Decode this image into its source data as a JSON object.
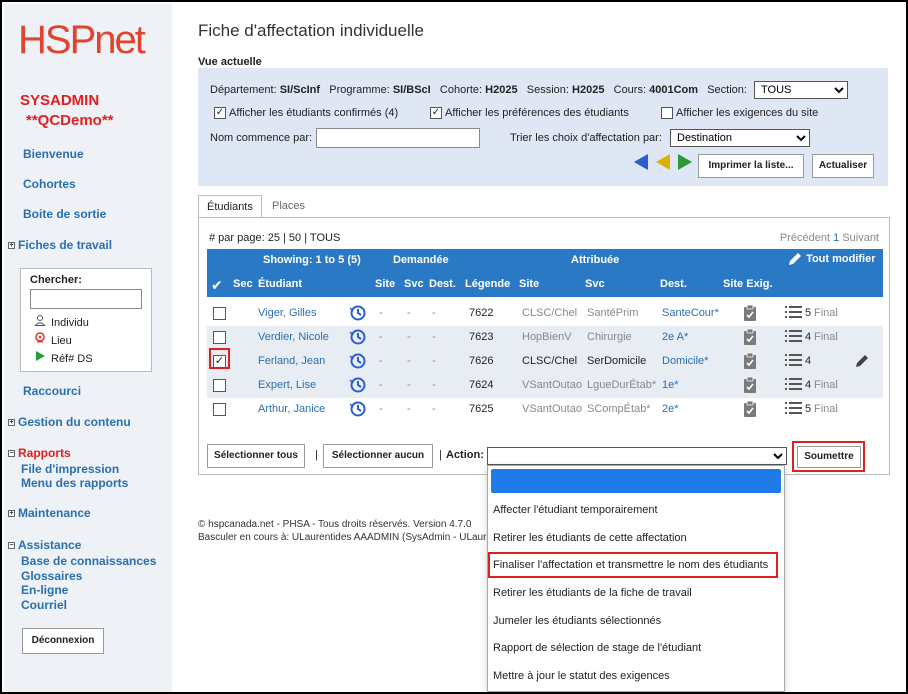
{
  "logo": {
    "hsp": "HSP",
    "net": "net"
  },
  "user": {
    "name": "SYSADMIN",
    "demo": "**QCDemo**"
  },
  "sidebar": {
    "links": [
      "Bienvenue",
      "Cohortes",
      "Boite de sortie"
    ],
    "fiches": "Fiches de travail",
    "search": {
      "label": "Chercher:",
      "options": [
        "Individu",
        "Lieu",
        "Réf# DS"
      ]
    },
    "raccourci": "Raccourci",
    "gestion": "Gestion du contenu",
    "rapports": "Rapports",
    "rapports_items": [
      "File d'impression",
      "Menu des rapports"
    ],
    "maintenance": "Maintenance",
    "assistance": "Assistance",
    "assistance_items": [
      "Base de connaissances",
      "Glossaires",
      "En-ligne",
      "Courriel"
    ],
    "logout": "Déconnexion"
  },
  "page": {
    "title": "Fiche d'affectation individuelle",
    "vue": "Vue actuelle"
  },
  "filter": {
    "dept_label": "Département:",
    "dept": "SI/ScInf",
    "prog_label": "Programme:",
    "prog": "SI/BScI",
    "cohorte_label": "Cohorte:",
    "cohorte": "H2025",
    "session_label": "Session:",
    "session": "H2025",
    "cours_label": "Cours:",
    "cours": "4001Com",
    "section_label": "Section:",
    "section": "TOUS",
    "cb1": "Afficher les étudiants confirmés (4)",
    "cb2": "Afficher les préférences des étudiants",
    "cb3": "Afficher les exigences du site",
    "nom_label": "Nom commence par:",
    "trier_label": "Trier les choix d'affectation par:",
    "trier": "Destination",
    "print_btn": "Imprimer la liste...",
    "refresh_btn": "Actualiser"
  },
  "tabs": [
    "Étudiants",
    "Places"
  ],
  "table": {
    "perpage": "# par page: 25 | 50 | TOUS",
    "prev": "Précédent",
    "page": "1",
    "next": "Suivant",
    "showing": "Showing: 1 to 5 (5)",
    "demandee": "Demandée",
    "attribuee": "Attribuée",
    "modify_all": "Tout modifier",
    "cols": [
      "Sec",
      "Étudiant",
      "Site",
      "Svc",
      "Dest.",
      "Légende",
      "Site",
      "Svc",
      "Dest.",
      "Site Exig."
    ],
    "rows": [
      {
        "name": "Viger, Gilles",
        "legend": "7622",
        "site": "CLSC/Chel",
        "svc": "SantéPrim",
        "dest": "SanteCour*",
        "count": "5",
        "status": "Final",
        "checked": false
      },
      {
        "name": "Verdier, Nicole",
        "legend": "7623",
        "site": "HopBienV",
        "svc": "Chirurgie",
        "dest": "2e A*",
        "count": "4",
        "status": "Final",
        "checked": false
      },
      {
        "name": "Ferland, Jean",
        "legend": "7626",
        "site": "CLSC/Chel",
        "svc": "SerDomicile",
        "dest": "Domicile*",
        "count": "4",
        "status": "",
        "checked": true
      },
      {
        "name": "Expert, Lise",
        "legend": "7624",
        "site": "VSantOutao",
        "svc": "LgueDurÉtab*",
        "dest": "1e*",
        "count": "4",
        "status": "Final",
        "checked": false
      },
      {
        "name": "Arthur, Janice",
        "legend": "7625",
        "site": "VSantOutao",
        "svc": "SCompÉtab*",
        "dest": "2e*",
        "count": "5",
        "status": "Final",
        "checked": false
      }
    ],
    "dash": "-",
    "select_all": "Sélectionner tous",
    "select_none": "Sélectionner aucun",
    "action_label": "Action:",
    "submit": "Soumettre"
  },
  "dropdown_items": [
    "Affecter l'étudiant temporairement",
    "Retirer les étudiants de cette affectation",
    "Finaliser l'affectation et transmettre le nom des étudiants",
    "Retirer les étudiants de la fiche de travail",
    "Jumeler les étudiants sélectionnés",
    "Rapport de sélection de stage de l'étudiant",
    "Mettre à jour le statut des exigences"
  ],
  "footer": {
    "copyright": "© hspcanada.net - PHSA - Tous droits réservés.    Version 4.7.0",
    "switch": "Basculer en cours à: ULaurentides AAADMIN (SysAdmin - ULaurent/"
  },
  "colors": {
    "brand": "#e0442f",
    "link": "#2a6fb0",
    "header": "#2a79c5",
    "highlight": "#e02020"
  }
}
